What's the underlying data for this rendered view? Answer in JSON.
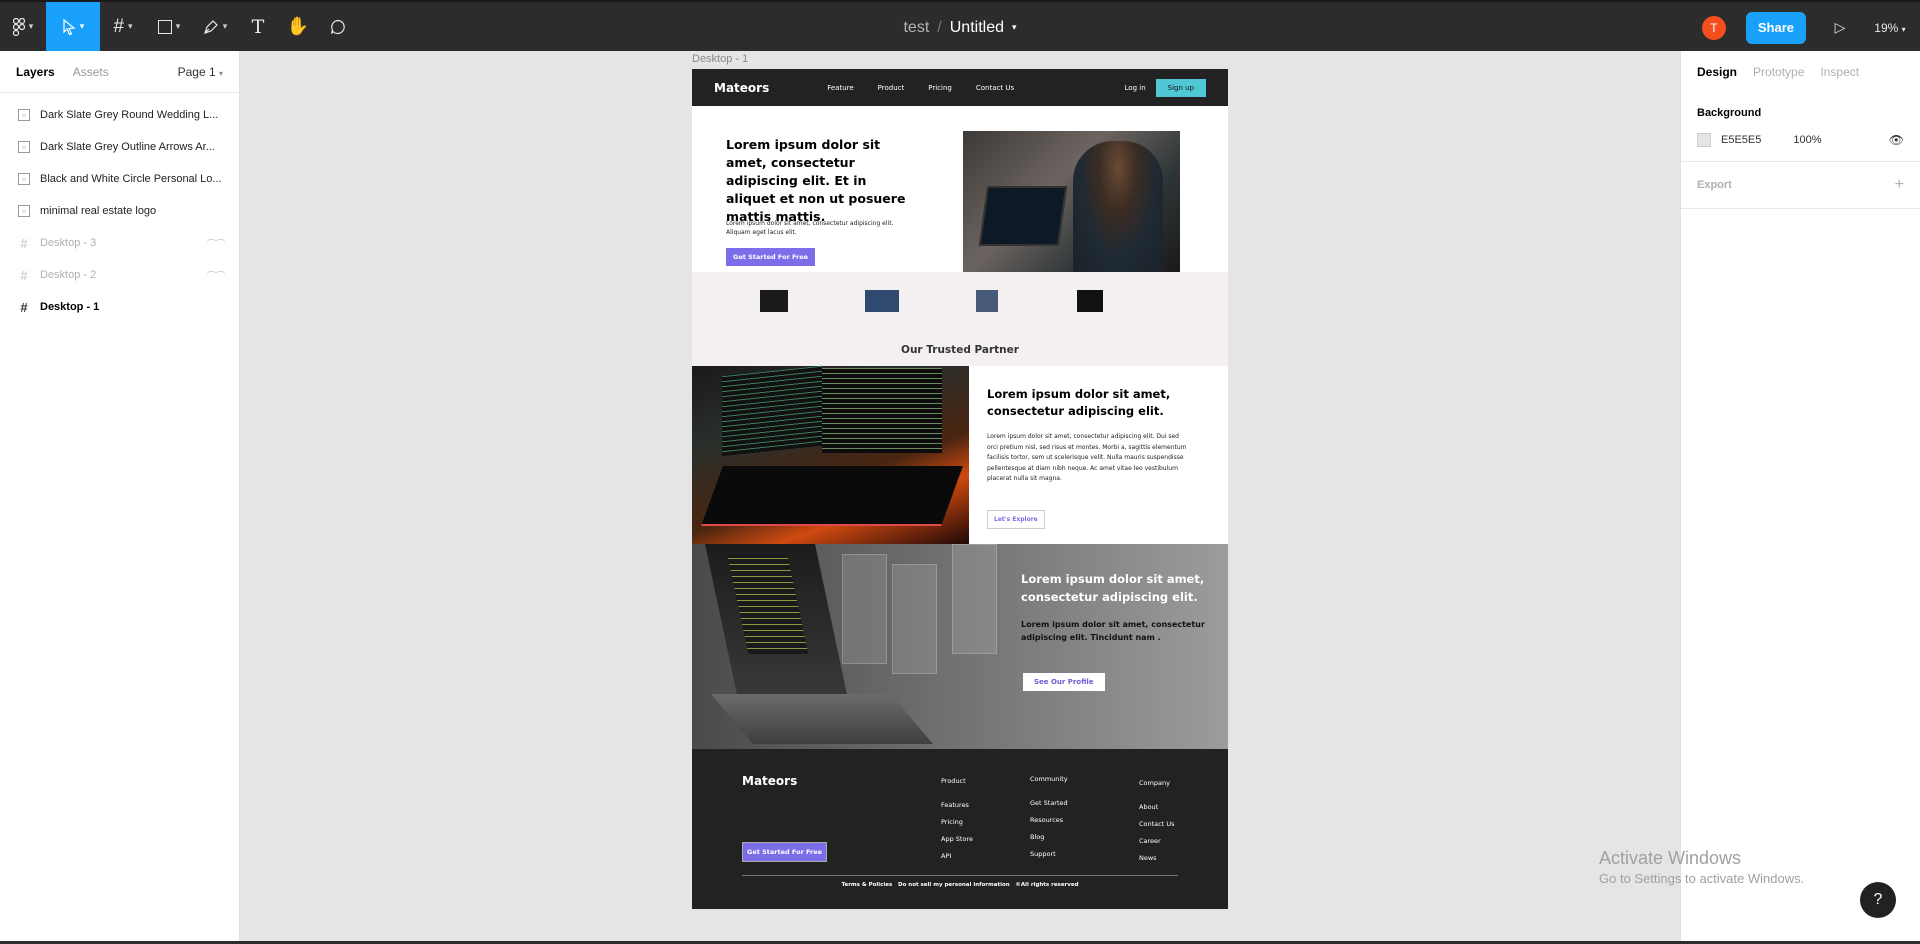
{
  "toolbar": {
    "project": "test",
    "separator": "/",
    "file_name": "Untitled",
    "avatar_initial": "T",
    "share_label": "Share",
    "zoom": "19%"
  },
  "left_panel": {
    "tabs": [
      "Layers",
      "Assets"
    ],
    "page": "Page 1",
    "layers": [
      {
        "name": "Dark Slate Grey Round Wedding L...",
        "type": "image"
      },
      {
        "name": "Dark Slate Grey Outline Arrows Ar...",
        "type": "image"
      },
      {
        "name": "Black and White Circle Personal Lo...",
        "type": "image"
      },
      {
        "name": "minimal real estate logo",
        "type": "image"
      },
      {
        "name": "Desktop - 3",
        "type": "frame",
        "hidden": true
      },
      {
        "name": "Desktop - 2",
        "type": "frame",
        "hidden": true
      },
      {
        "name": "Desktop - 1",
        "type": "frame",
        "selected": true
      }
    ]
  },
  "right_panel": {
    "tabs": [
      "Design",
      "Prototype",
      "Inspect"
    ],
    "background_label": "Background",
    "background_hex": "E5E5E5",
    "background_opacity": "100%",
    "export_label": "Export"
  },
  "canvas": {
    "frame_label": "Desktop - 1",
    "nav": {
      "logo": "Mateors",
      "links": [
        "Feature",
        "Product",
        "Pricing",
        "Contact Us"
      ],
      "login": "Log in",
      "signup": "Sign up"
    },
    "hero": {
      "heading": "Lorem ipsum dolor sit amet, consectetur adipiscing elit. Et in aliquet et non ut posuere mattis mattis.",
      "body": "Lorem ipsum dolor sit amet, consectetur adipiscing elit. Aliquam eget lacus elit.",
      "cta": "Get Started For Free"
    },
    "partners": {
      "title": "Our Trusted Partner"
    },
    "section2": {
      "heading": "Lorem ipsum dolor sit amet, consectetur adipiscing elit.",
      "body": "Lorem ipsum dolor sit amet, consectetur adipiscing elit. Dui sed orci pretium nisl, sed risus et montes. Morbi a, sagittis elementum facilisis tortor, sem ut scelerisque velit. Nulla mauris suspendisse pellentesque at diam nibh neque. Ac amet vitae leo vestibulum placerat nulla sit magna.",
      "button": "Let's Explore"
    },
    "section3": {
      "heading": "Lorem ipsum dolor sit amet, consectetur adipiscing elit.",
      "body": "Lorem ipsum dolor sit amet, consectetur adipiscing elit. Tincidunt nam .",
      "button": "See Our Profile"
    },
    "footer": {
      "logo": "Mateors",
      "cta": "Get Started For Free",
      "columns": [
        {
          "heading": "Product",
          "items": [
            "Features",
            "Pricing",
            "App Store",
            "API"
          ]
        },
        {
          "heading": "Community",
          "items": [
            "Get Started",
            "Resources",
            "Blog",
            "Support"
          ]
        },
        {
          "heading": "Company",
          "items": [
            "About",
            "Contact Us",
            "Career",
            "News"
          ]
        }
      ],
      "legal": "Terms & Policies   Do not sell my personal information   ©All rights reserved"
    }
  },
  "watermark": {
    "line1": "Activate Windows",
    "line2": "Go to Settings to activate Windows."
  },
  "help": "?"
}
